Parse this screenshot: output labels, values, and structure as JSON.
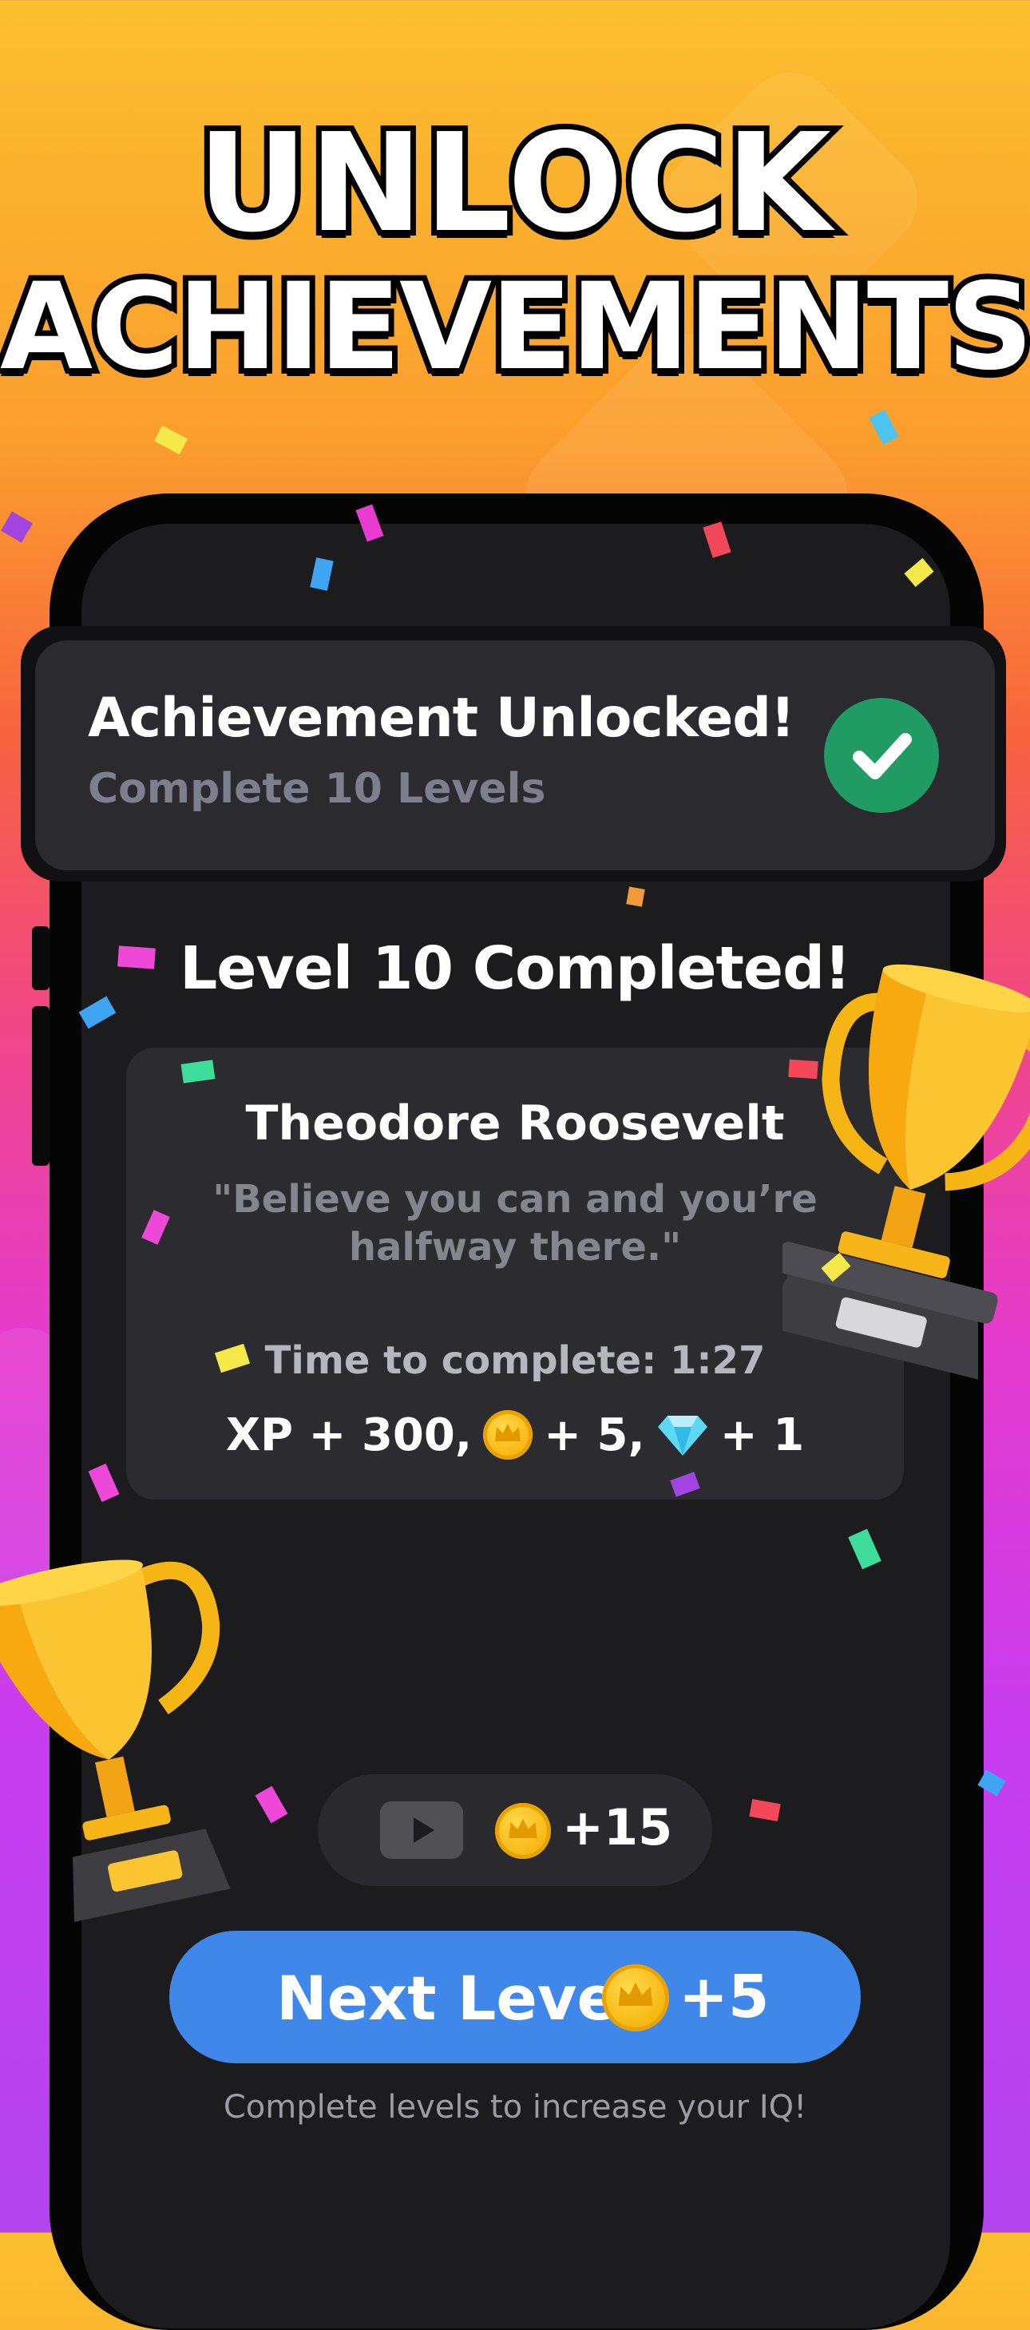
{
  "headline": {
    "line1": "UNLOCK",
    "line2": "ACHIEVEMENTS"
  },
  "toast": {
    "title": "Achievement Unlocked!",
    "subtitle": "Complete 10 Levels",
    "check_color": "#1f9b63"
  },
  "level": {
    "title": "Level 10 Completed!",
    "author": "Theodore Roosevelt",
    "quote": "\"Believe you can and you’re halfway there.\"",
    "time": "Time to complete: 1:27",
    "xp": "XP + 300,",
    "coins": "+ 5,",
    "gems": "+ 1"
  },
  "video_reward": {
    "icon": "play-icon",
    "amount": "+15"
  },
  "next_button": {
    "label": "Next Level",
    "amount": "+5",
    "color": "#3f87e9"
  },
  "footer": "Complete levels to increase your IQ!",
  "icons": [
    "check-icon",
    "coin-crown-icon",
    "gem-icon",
    "play-icon",
    "trophy-icon"
  ]
}
